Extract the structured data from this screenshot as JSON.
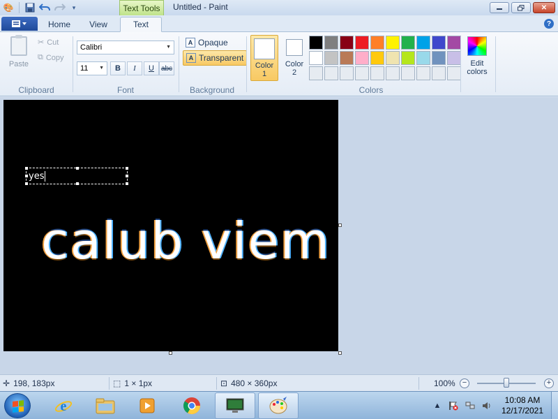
{
  "titlebar": {
    "title": "Untitled - Paint",
    "contextual_tab": "Text Tools"
  },
  "tabs": {
    "home": "Home",
    "view": "View",
    "text": "Text"
  },
  "ribbon": {
    "clipboard": {
      "paste": "Paste",
      "cut": "Cut",
      "copy": "Copy",
      "label": "Clipboard"
    },
    "font": {
      "family": "Calibri",
      "size": "11",
      "bold": "B",
      "italic": "I",
      "underline": "U",
      "strike": "abc",
      "label": "Font"
    },
    "background": {
      "opaque": "Opaque",
      "transparent": "Transparent",
      "label": "Background"
    },
    "colors": {
      "color1_line1": "Color",
      "color1_line2": "1",
      "color2_line1": "Color",
      "color2_line2": "2",
      "edit_line1": "Edit",
      "edit_line2": "colors",
      "label": "Colors",
      "color1_value": "#ffffff",
      "color2_value": "#ffffff",
      "palette_row1": [
        "#000000",
        "#7f7f7f",
        "#880015",
        "#ed1c24",
        "#ff7f27",
        "#fff200",
        "#22b14c",
        "#00a2e8",
        "#3f48cc",
        "#a349a4"
      ],
      "palette_row2": [
        "#ffffff",
        "#c3c3c3",
        "#b97a57",
        "#ffaec9",
        "#ffc90e",
        "#efe4b0",
        "#b5e61d",
        "#99d9ea",
        "#7092be",
        "#c8bfe7"
      ],
      "palette_row3": [
        "#e6ebf1",
        "#e6ebf1",
        "#e6ebf1",
        "#e6ebf1",
        "#e6ebf1",
        "#e6ebf1",
        "#e6ebf1",
        "#e6ebf1",
        "#e6ebf1",
        "#e6ebf1"
      ]
    }
  },
  "canvas": {
    "textbox_text": "yes",
    "big_text": "calub viem"
  },
  "status": {
    "cursor_pos": "198, 183px",
    "selection_size": "1 × 1px",
    "canvas_size": "480 × 360px",
    "zoom": "100%"
  },
  "taskbar": {
    "time": "10:08 AM",
    "date": "12/17/2021"
  }
}
